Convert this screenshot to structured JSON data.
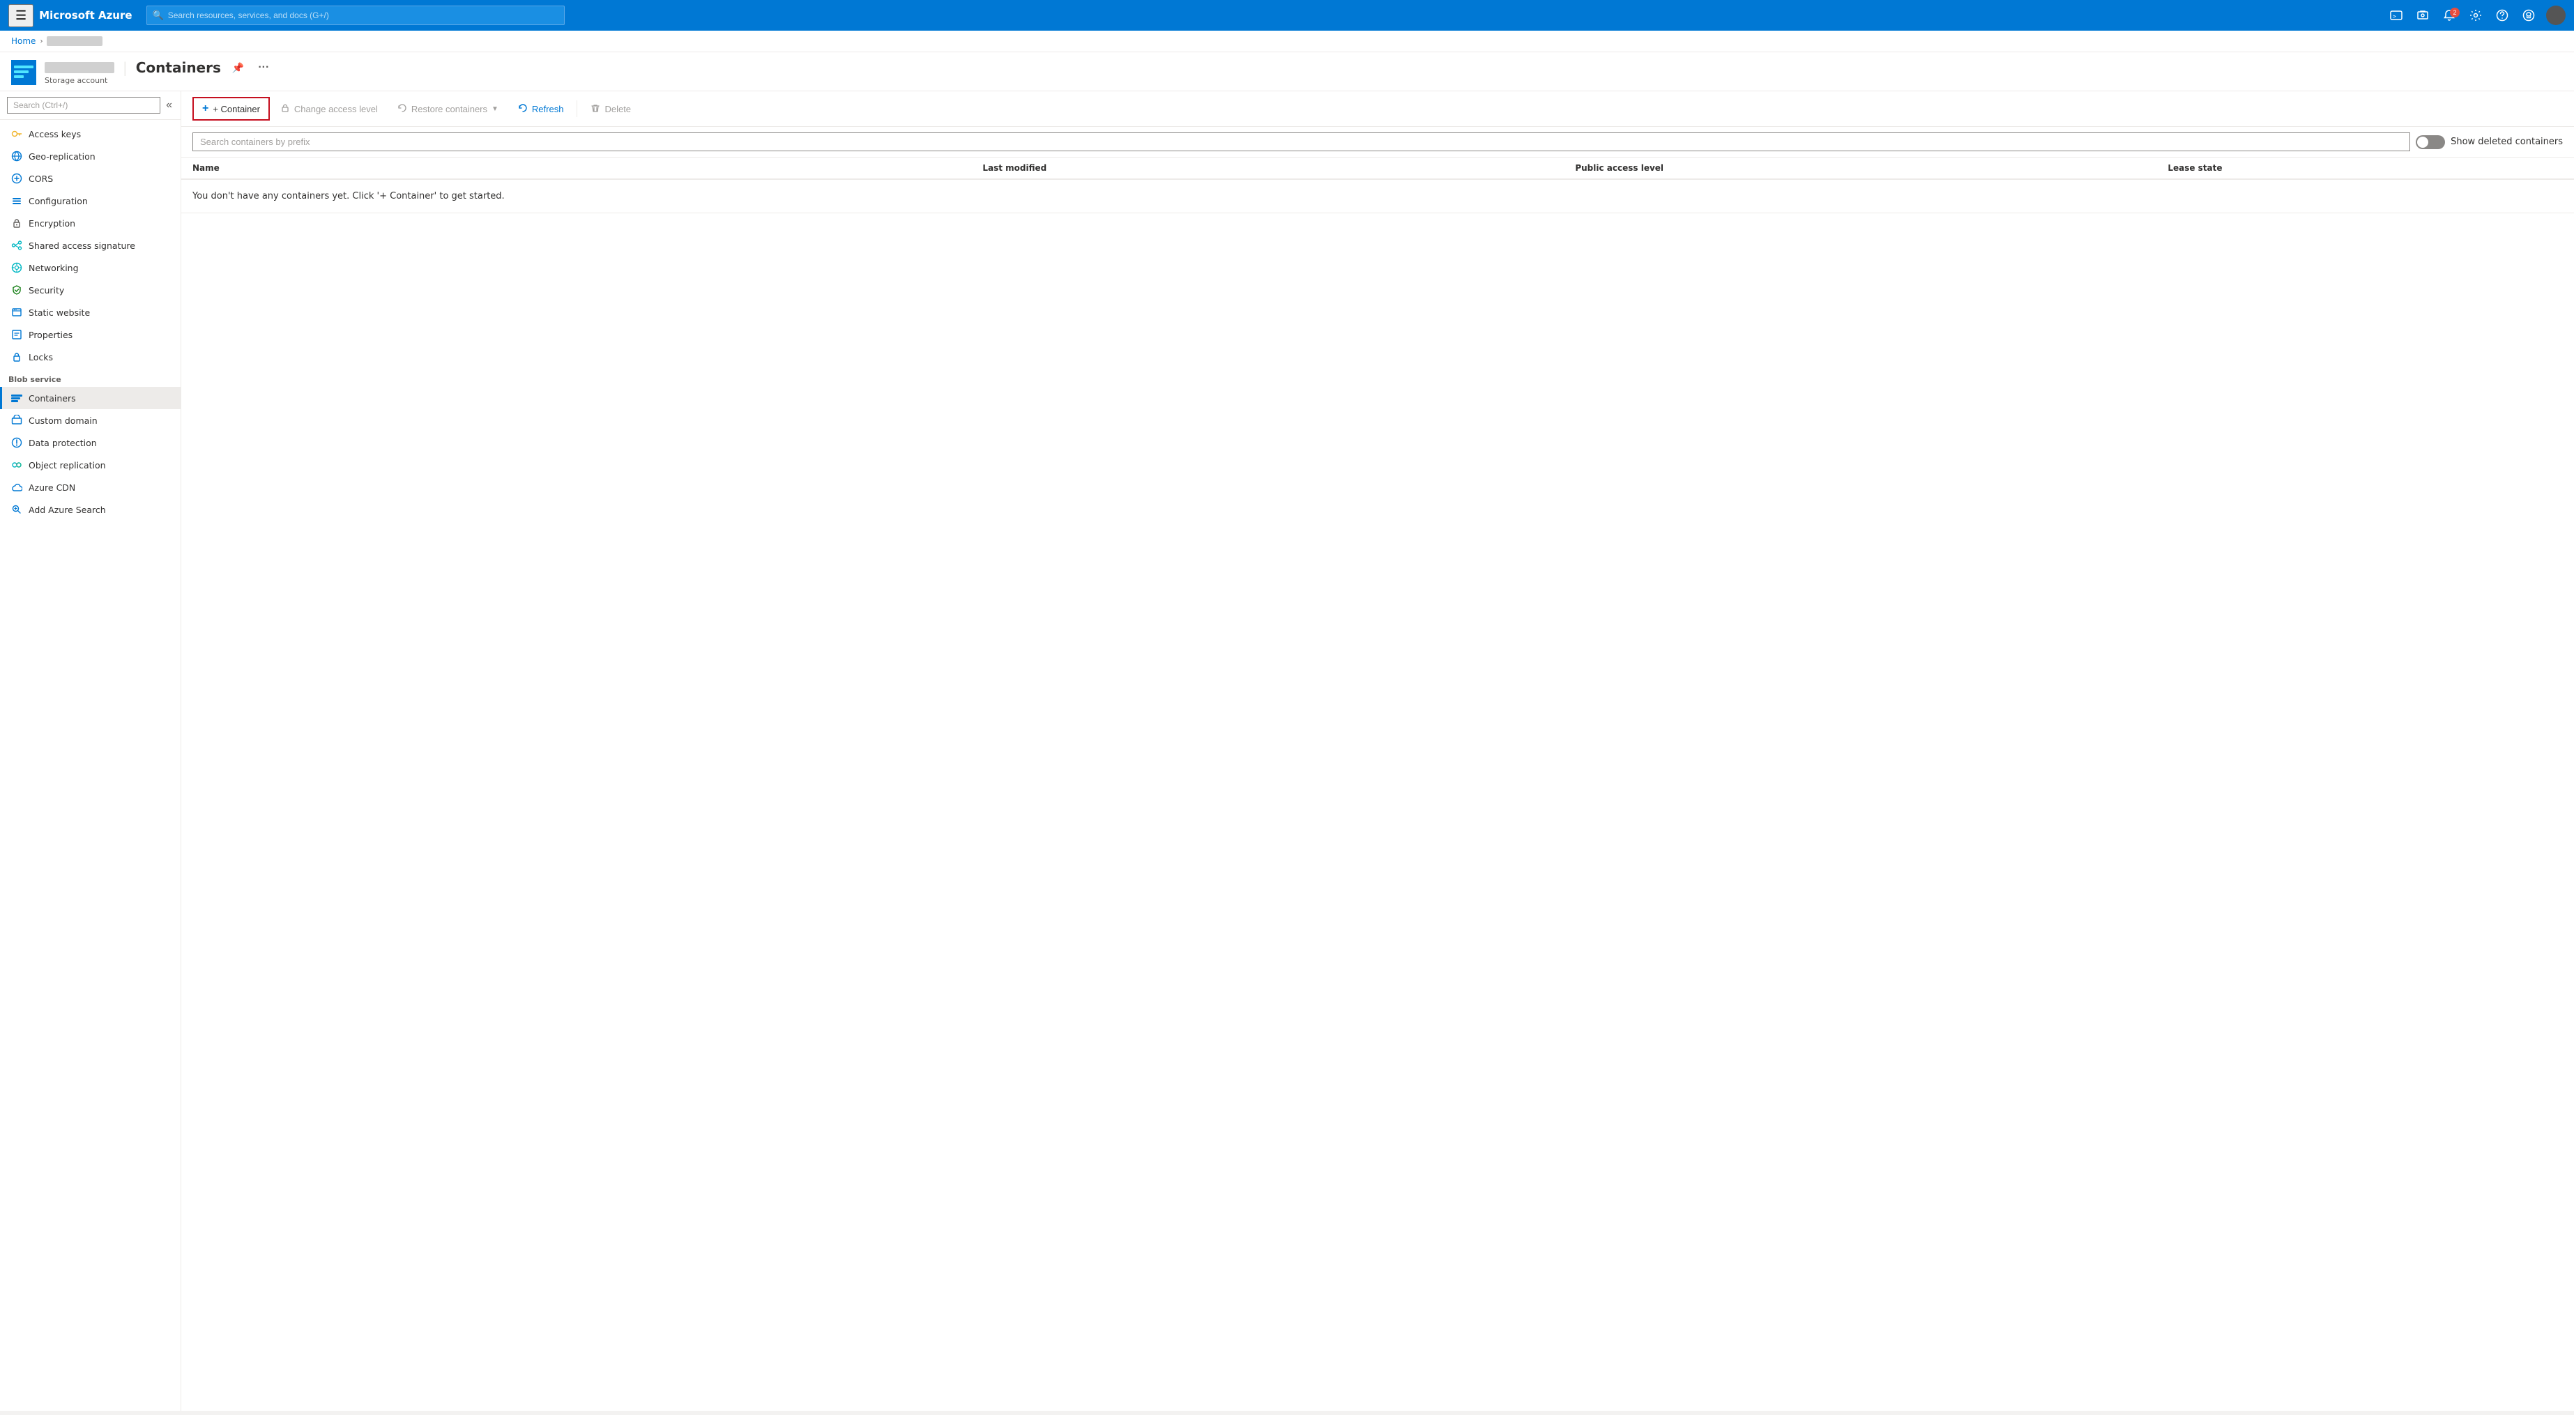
{
  "topbar": {
    "brand": "Microsoft Azure",
    "search_placeholder": "Search resources, services, and docs (G+/)",
    "notification_count": "2"
  },
  "breadcrumb": {
    "home": "Home"
  },
  "page_header": {
    "subtitle": "Storage account",
    "title": "Containers",
    "pin_icon": "📌",
    "more_icon": "···"
  },
  "sidebar": {
    "search_placeholder": "Search (Ctrl+/)",
    "items_above_fold": [
      {
        "id": "access-keys",
        "label": "Access keys",
        "icon": "key"
      },
      {
        "id": "geo-replication",
        "label": "Geo-replication",
        "icon": "globe"
      },
      {
        "id": "cors",
        "label": "CORS",
        "icon": "cors"
      },
      {
        "id": "configuration",
        "label": "Configuration",
        "icon": "config"
      },
      {
        "id": "encryption",
        "label": "Encryption",
        "icon": "encrypt"
      },
      {
        "id": "shared-access",
        "label": "Shared access signature",
        "icon": "shared"
      },
      {
        "id": "networking",
        "label": "Networking",
        "icon": "network"
      },
      {
        "id": "security",
        "label": "Security",
        "icon": "security"
      },
      {
        "id": "static-website",
        "label": "Static website",
        "icon": "static"
      },
      {
        "id": "properties",
        "label": "Properties",
        "icon": "props"
      },
      {
        "id": "locks",
        "label": "Locks",
        "icon": "lock"
      }
    ],
    "blob_section_label": "Blob service",
    "blob_items": [
      {
        "id": "containers",
        "label": "Containers",
        "icon": "containers",
        "selected": true
      },
      {
        "id": "custom-domain",
        "label": "Custom domain",
        "icon": "domain"
      },
      {
        "id": "data-protection",
        "label": "Data protection",
        "icon": "data-protection"
      },
      {
        "id": "object-replication",
        "label": "Object replication",
        "icon": "replication"
      },
      {
        "id": "azure-cdn",
        "label": "Azure CDN",
        "icon": "cdn"
      },
      {
        "id": "add-azure-search",
        "label": "Add Azure Search",
        "icon": "search"
      }
    ]
  },
  "toolbar": {
    "add_container": "+ Container",
    "change_access": "Change access level",
    "restore_containers": "Restore containers",
    "refresh": "Refresh",
    "delete": "Delete"
  },
  "content": {
    "search_placeholder": "Search containers by prefix",
    "show_deleted_label": "Show deleted containers",
    "table_headers": [
      "Name",
      "Last modified",
      "Public access level",
      "Lease state"
    ],
    "empty_message": "You don't have any containers yet. Click '+ Container' to get started."
  }
}
